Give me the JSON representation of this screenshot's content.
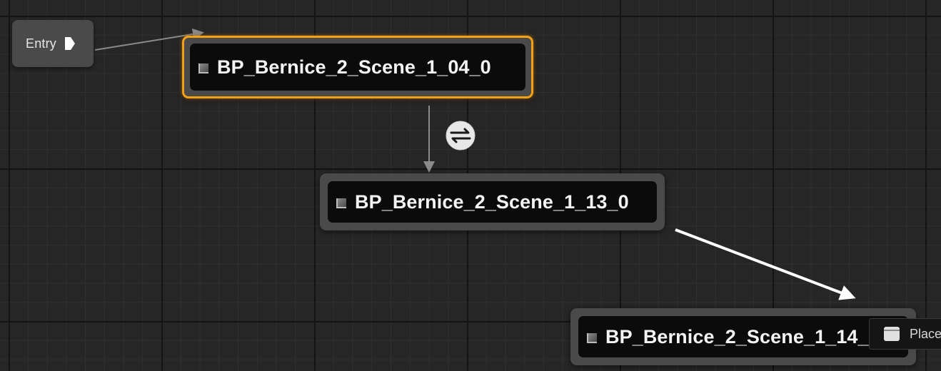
{
  "entry": {
    "label": "Entry"
  },
  "states": [
    {
      "id": "node-04",
      "title": "BP_Bernice_2_Scene_1_04_0",
      "selected": true
    },
    {
      "id": "node-13",
      "title": "BP_Bernice_2_Scene_1_13_0",
      "selected": false
    },
    {
      "id": "node-14",
      "title": "BP_Bernice_2_Scene_1_14_0",
      "selected": false
    }
  ],
  "tooltip": {
    "label": "Placeholder"
  },
  "colors": {
    "selection_outline": "#f3a019",
    "node_body": "#4a4a4a",
    "node_title_bar": "#0b0b0b",
    "graph_background": "#262626"
  },
  "icons": {
    "entry_pin": "exec-pin-icon",
    "state": "state-node-icon",
    "transition": "transition-rule-icon",
    "placeholder": "window-icon"
  }
}
